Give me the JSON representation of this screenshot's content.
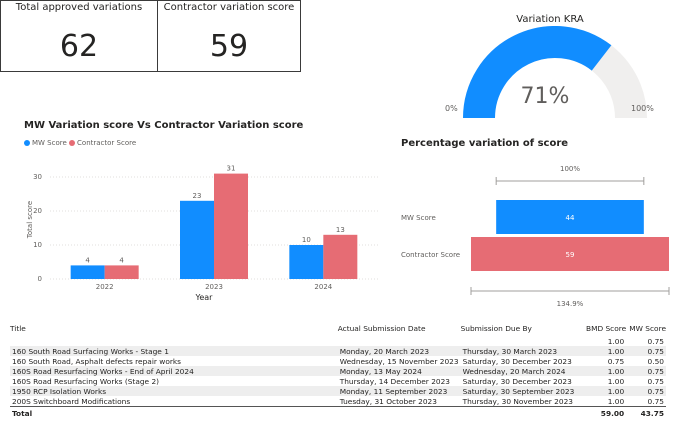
{
  "cards": [
    {
      "title": "Total approved variations",
      "value": "62"
    },
    {
      "title": "Contractor variation score",
      "value": "59"
    }
  ],
  "gauge": {
    "title": "Variation KRA",
    "value_label": "71%",
    "value": 71,
    "min_label": "0%",
    "max_label": "100%",
    "fill_color": "#118dff",
    "track_color": "#f0efee"
  },
  "colors": {
    "mw": "#118dff",
    "contractor": "#e66c74"
  },
  "chart_data": [
    {
      "type": "bar",
      "title": "MW Variation score Vs Contractor Variation score",
      "legend": [
        "MW Score",
        "Contractor Score"
      ],
      "legend_position": "top-left",
      "categories": [
        "2022",
        "2023",
        "2024"
      ],
      "series": [
        {
          "name": "MW Score",
          "values": [
            4,
            23,
            10
          ]
        },
        {
          "name": "Contractor Score",
          "values": [
            4,
            31,
            13
          ]
        }
      ],
      "xlabel": "Year",
      "ylabel": "Total score",
      "yticks": [
        "0",
        "10",
        "20",
        "30"
      ],
      "ylim": [
        0,
        35
      ]
    },
    {
      "type": "bar",
      "title": "Percentage variation of score",
      "categories": [
        "MW Score",
        "Contractor Score"
      ],
      "values": [
        44,
        59
      ],
      "top_label": "100%",
      "bottom_label": "134.9%"
    }
  ],
  "table": {
    "headers": [
      "Title",
      "Actual Submission Date",
      "Submission Due By",
      "BMD Score",
      "MW Score"
    ],
    "rows": [
      [
        "",
        "",
        "",
        "1.00",
        "0.75"
      ],
      [
        "160 South Road Surfacing Works - Stage 1",
        "Monday, 20 March 2023",
        "Thursday, 30 March 2023",
        "1.00",
        "0.75"
      ],
      [
        "160 South Road, Asphalt defects repair works",
        "Wednesday, 15 November 2023",
        "Saturday, 30 December 2023",
        "0.75",
        "0.50"
      ],
      [
        "160S Road Resurfacing Works - End of April 2024",
        "Monday, 13 May 2024",
        "Wednesday, 20 March 2024",
        "1.00",
        "0.75"
      ],
      [
        "160S Road Resurfacing Works (Stage 2)",
        "Thursday, 14 December 2023",
        "Saturday, 30 December 2023",
        "1.00",
        "0.75"
      ],
      [
        "1950 RCP Isolation Works",
        "Monday, 11 September 2023",
        "Saturday, 30 September 2023",
        "1.00",
        "0.75"
      ],
      [
        "200S Switchboard Modifications",
        "Tuesday, 31 October 2023",
        "Thursday, 30 November 2023",
        "1.00",
        "0.75"
      ]
    ],
    "total": [
      "Total",
      "",
      "",
      "59.00",
      "43.75"
    ]
  }
}
